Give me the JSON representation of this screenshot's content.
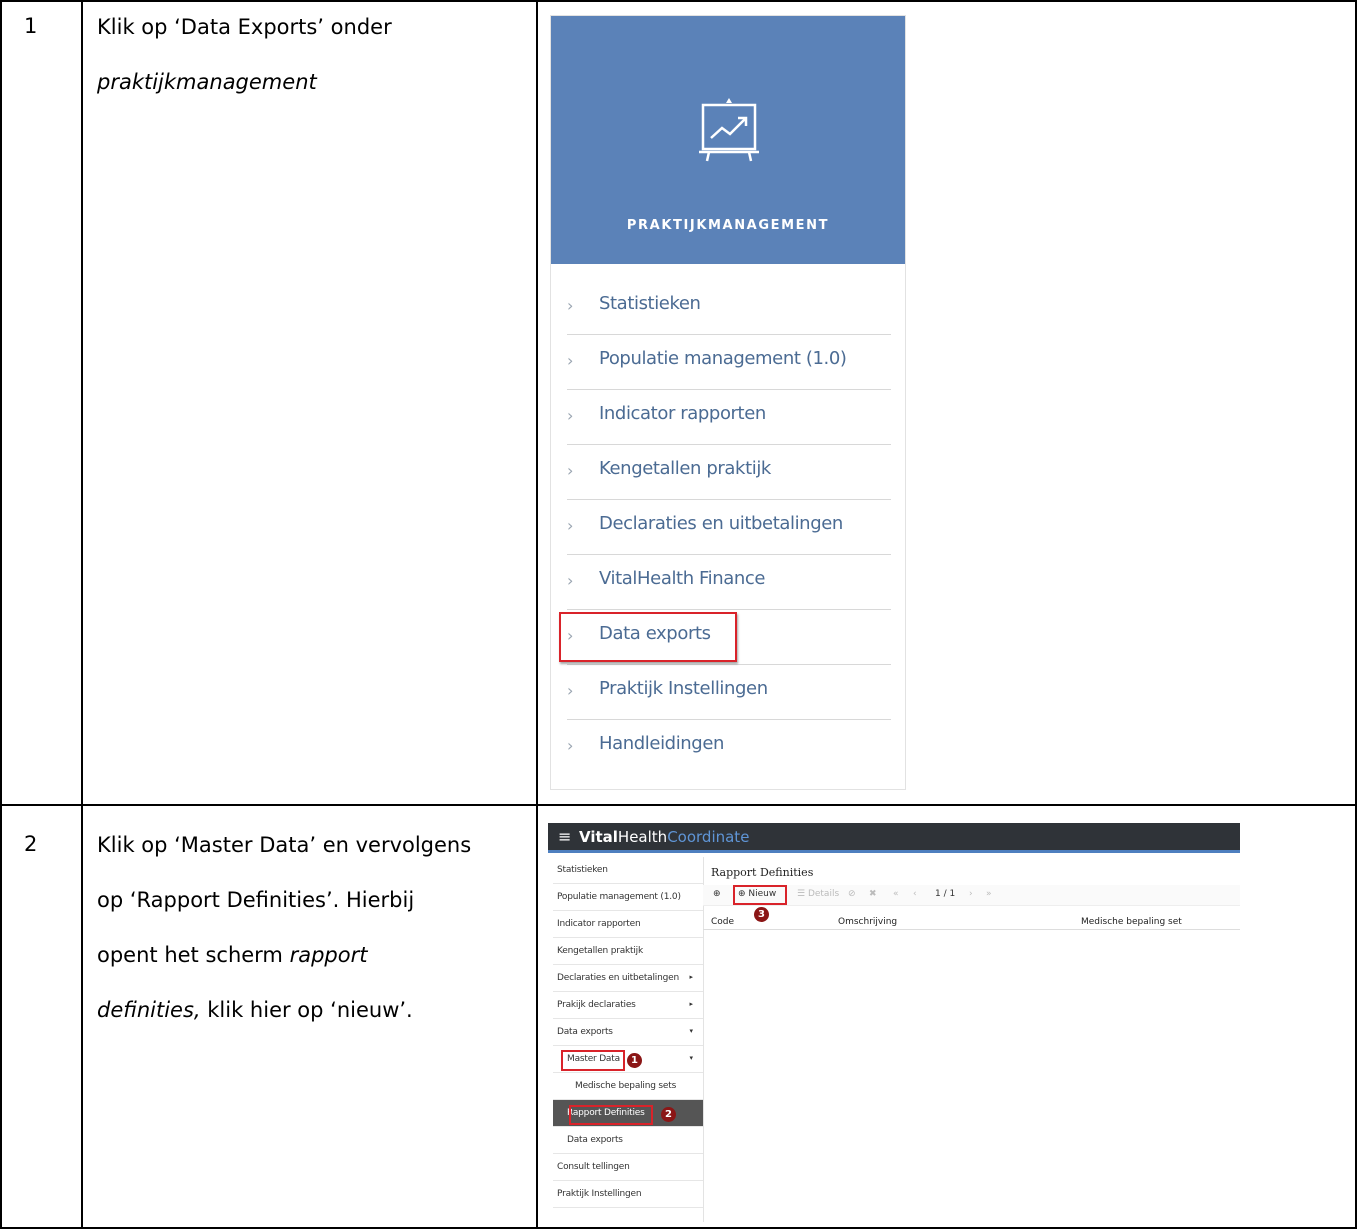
{
  "steps": [
    {
      "number": "1",
      "lines": [
        {
          "parts": [
            {
              "text": "Klik op ‘Data Exports’ onder",
              "italic": false
            }
          ]
        },
        {
          "parts": [
            {
              "text": "praktijkmanagement",
              "italic": true
            }
          ]
        }
      ]
    },
    {
      "number": "2",
      "lines": [
        {
          "parts": [
            {
              "text": "Klik op ‘Master Data’ en vervolgens",
              "italic": false
            }
          ]
        },
        {
          "parts": [
            {
              "text": "op ‘Rapport Definities’. Hierbij",
              "italic": false
            }
          ]
        },
        {
          "parts": [
            {
              "text": "opent het scherm ",
              "italic": false
            },
            {
              "text": "rapport",
              "italic": true
            }
          ]
        },
        {
          "parts": [
            {
              "text": "definities,",
              "italic": true
            },
            {
              "text": " klik hier op ‘nieuw’.",
              "italic": false
            }
          ]
        }
      ]
    }
  ],
  "tile": {
    "title": "PRAKTIJKMANAGEMENT",
    "header_color": "#5b82b8",
    "icon": "presentation-chart-icon",
    "items": [
      "Statistieken",
      "Populatie management (1.0)",
      "Indicator rapporten",
      "Kengetallen praktijk",
      "Declaraties en uitbetalingen",
      "VitalHealth Finance",
      "Data exports",
      "Praktijk Instellingen",
      "Handleidingen"
    ],
    "highlighted_item": "Data exports"
  },
  "app": {
    "brand_bold": "Vital",
    "brand_regular": "Health",
    "brand_accent": "Coordinate",
    "accent_color": "#5f95d6",
    "sidebar": [
      {
        "label": "Statistieken"
      },
      {
        "label": "Populatie management (1.0)"
      },
      {
        "label": "Indicator rapporten"
      },
      {
        "label": "Kengetallen praktijk"
      },
      {
        "label": "Declaraties en uitbetalingen",
        "arrow": "▸"
      },
      {
        "label": "Prakijk declaraties",
        "arrow": "▸"
      },
      {
        "label": "Data exports",
        "arrow": "▾"
      },
      {
        "label": "Master Data",
        "arrow": "▾",
        "badge": "1"
      },
      {
        "label": "Medische bepaling sets"
      },
      {
        "label": "Rapport Definities",
        "badge": "2"
      },
      {
        "label": "Data exports"
      },
      {
        "label": "Consult tellingen"
      },
      {
        "label": "Praktijk Instellingen"
      }
    ],
    "content_title": "Rapport Definities",
    "toolbar": {
      "new_label": "Nieuw",
      "details_label": "Details",
      "pager": "1 / 1",
      "badge": "3"
    },
    "columns": [
      "Code",
      "Omschrijving",
      "Medische bepaling set"
    ]
  }
}
